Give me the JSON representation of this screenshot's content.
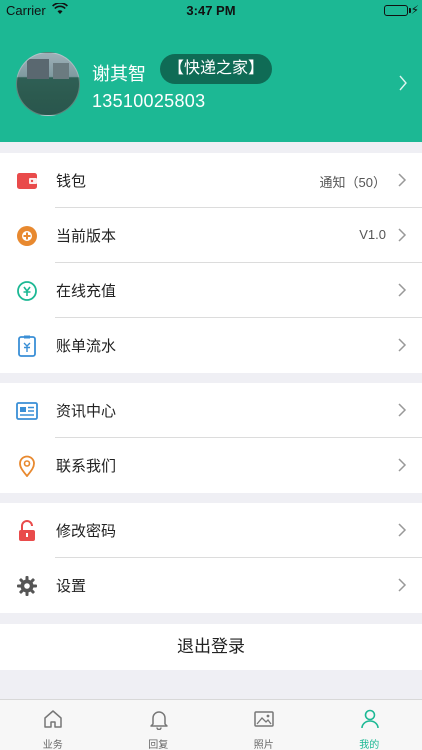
{
  "status_bar": {
    "carrier": "Carrier",
    "time": "3:47 PM"
  },
  "profile": {
    "name": "谢其智",
    "tag": "【快递之家】",
    "phone": "13510025803"
  },
  "menu_groups": [
    {
      "items": [
        {
          "label": "钱包",
          "value": "通知（50）",
          "icon": "wallet-icon"
        },
        {
          "label": "当前版本",
          "value": "V1.0",
          "icon": "version-icon"
        },
        {
          "label": "在线充值",
          "value": "",
          "icon": "recharge-icon"
        },
        {
          "label": "账单流水",
          "value": "",
          "icon": "bill-icon"
        }
      ]
    },
    {
      "items": [
        {
          "label": "资讯中心",
          "value": "",
          "icon": "news-icon"
        },
        {
          "label": "联系我们",
          "value": "",
          "icon": "location-pin-icon"
        }
      ]
    },
    {
      "items": [
        {
          "label": "修改密码",
          "value": "",
          "icon": "lock-icon"
        },
        {
          "label": "设置",
          "value": "",
          "icon": "gear-icon"
        }
      ]
    }
  ],
  "logout_label": "退出登录",
  "tabbar": {
    "tabs": [
      {
        "label": "业务",
        "icon": "home-icon",
        "active": false
      },
      {
        "label": "回复",
        "icon": "bell-icon",
        "active": false
      },
      {
        "label": "照片",
        "icon": "image-icon",
        "active": false
      },
      {
        "label": "我的",
        "icon": "person-icon",
        "active": true
      }
    ]
  },
  "colors": {
    "brand": "#1cb894",
    "tag_bg": "#0f6b55",
    "wallet": "#e94b4b",
    "version": "#e8892f",
    "recharge": "#1cb894",
    "bill": "#3a8fd6",
    "news": "#3a8fd6",
    "contact": "#e8892f",
    "lock": "#e94b4b",
    "gear": "#555555"
  }
}
